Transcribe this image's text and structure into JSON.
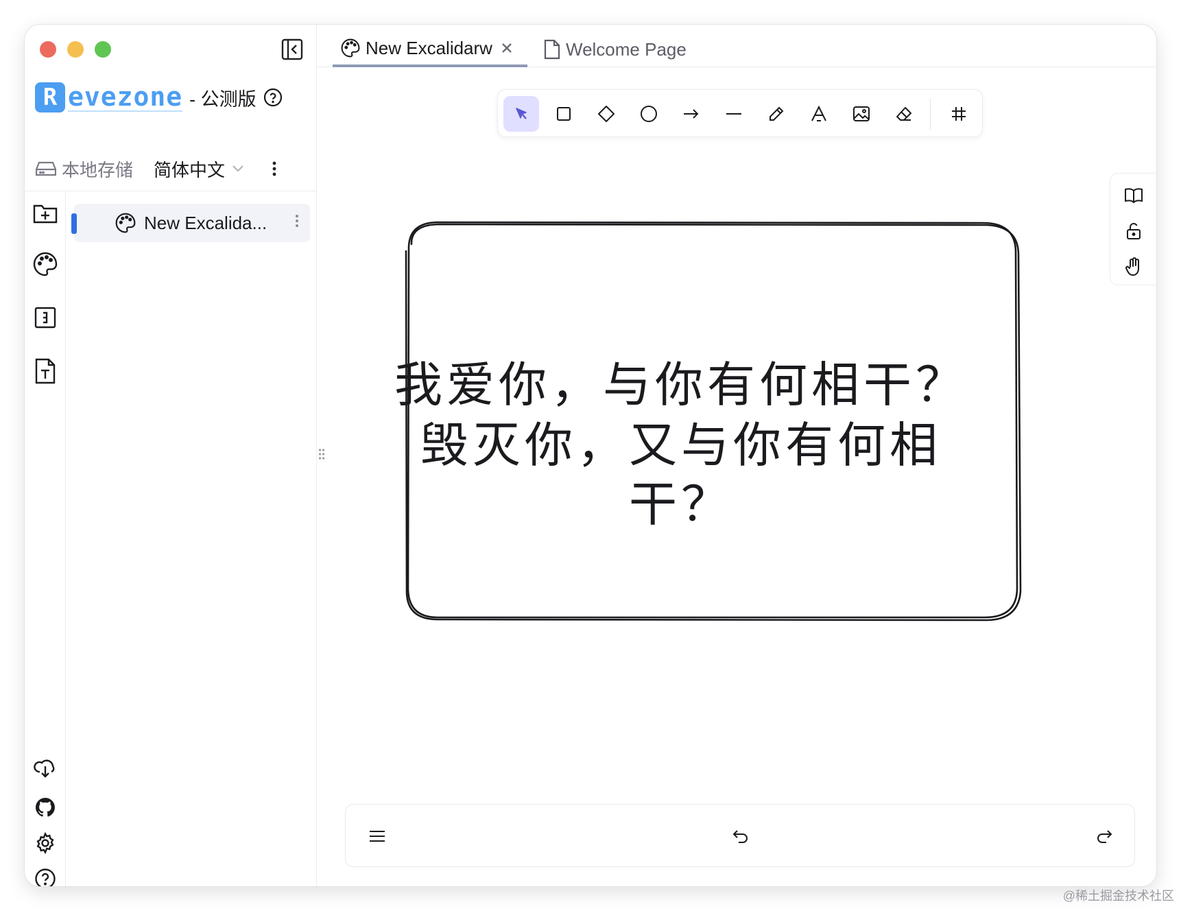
{
  "sidebar": {
    "brand_initial": "R",
    "brand_rest": "evezone",
    "brand_suffix": "- 公测版",
    "storage_label": "本地存储",
    "language_selected": "简体中文",
    "files": [
      {
        "name": "New Excalida..."
      }
    ]
  },
  "tabs": [
    {
      "label": "New Excalidarw",
      "active": true
    },
    {
      "label": "Welcome Page",
      "active": false
    }
  ],
  "canvas": {
    "text_line1": "我爱你，与你有何相干？",
    "text_line2": "毁灭你，又与你有何相干？"
  },
  "colors": {
    "brand": "#4c9ef2",
    "active_tool_bg": "#e0dfff",
    "active_tool_icon": "#5b57d1",
    "file_accent": "#2f6fe0"
  },
  "watermark": "@稀土掘金技术社区"
}
